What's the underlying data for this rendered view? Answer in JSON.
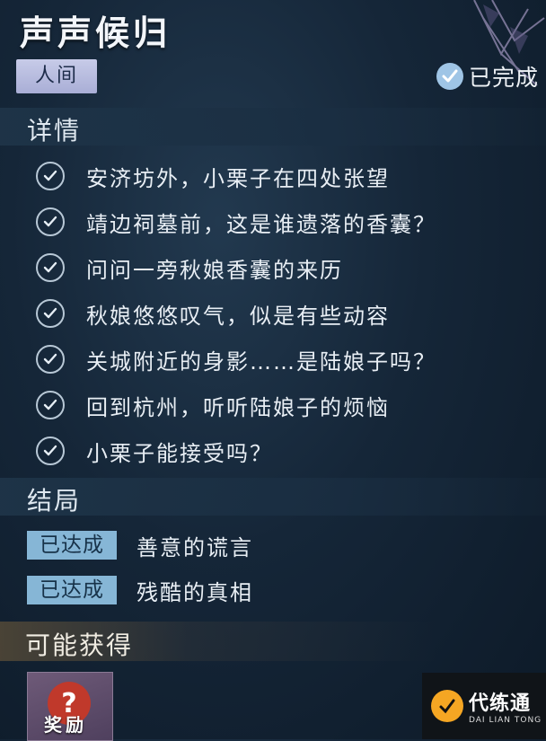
{
  "quest": {
    "title": "声声候归",
    "category": "人间",
    "status_label": "已完成"
  },
  "details": {
    "header": "详情",
    "tasks": [
      {
        "text": "安济坊外，小栗子在四处张望",
        "done": true
      },
      {
        "text": "靖边祠墓前，这是谁遗落的香囊？",
        "done": true
      },
      {
        "text": "问问一旁秋娘香囊的来历",
        "done": true
      },
      {
        "text": "秋娘悠悠叹气，似是有些动容",
        "done": true
      },
      {
        "text": "关城附近的身影……是陆娘子吗？",
        "done": true
      },
      {
        "text": "回到杭州，听听陆娘子的烦恼",
        "done": true
      },
      {
        "text": "小栗子能接受吗？",
        "done": true
      }
    ]
  },
  "endings": {
    "header": "结局",
    "items": [
      {
        "badge": "已达成",
        "text": "善意的谎言"
      },
      {
        "badge": "已达成",
        "text": "残酷的真相"
      }
    ]
  },
  "rewards": {
    "header": "可能获得",
    "item_label": "奖励",
    "item_icon": "?"
  },
  "watermark": {
    "name": "代练通",
    "subtitle": "DAI LIAN TONG"
  },
  "colors": {
    "background": "#152638",
    "badge": "#86b6d6",
    "category_tag": "#b4b8de",
    "check_stroke": "#b8c8d6"
  }
}
